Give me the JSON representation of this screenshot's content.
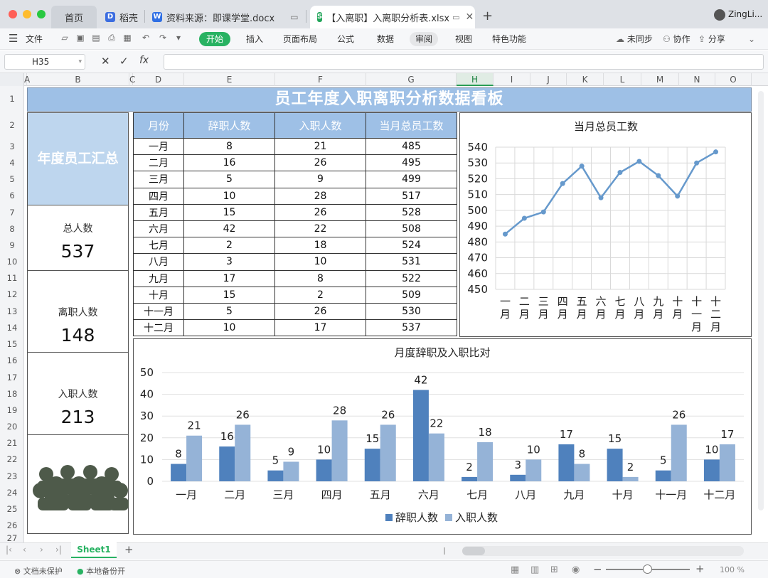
{
  "titlebar": {
    "tabs": [
      {
        "label": "首页"
      },
      {
        "label": "稻壳"
      },
      {
        "label": "资料来源：即课学堂.docx"
      },
      {
        "label": "【入离职】入离职分析表.xlsx"
      }
    ],
    "new_tab": "+",
    "user": "ZingLi..."
  },
  "menu": {
    "file": "文件",
    "items": [
      "开始",
      "插入",
      "页面布局",
      "公式",
      "数据",
      "审阅",
      "视图",
      "特色功能"
    ],
    "right": [
      "未同步",
      "协作",
      "分享"
    ]
  },
  "formula": {
    "cell_ref": "H35",
    "fx": "fx",
    "value": ""
  },
  "columns": [
    "A",
    "B",
    "C",
    "D",
    "E",
    "F",
    "G",
    "H",
    "I",
    "J",
    "K",
    "L",
    "M",
    "N",
    "O"
  ],
  "rows": [
    "1",
    "2",
    "3",
    "4",
    "5",
    "6",
    "7",
    "8",
    "9",
    "10",
    "11",
    "12",
    "13",
    "14",
    "15",
    "16",
    "17",
    "18",
    "19",
    "20",
    "21",
    "22",
    "23",
    "24",
    "25",
    "26",
    "27"
  ],
  "dashboard": {
    "title": "员工年度入职离职分析数据看板",
    "summary_header": "年度员工汇总",
    "kpis": [
      {
        "label": "总人数",
        "value": "537"
      },
      {
        "label": "离职人数",
        "value": "148"
      },
      {
        "label": "入职人数",
        "value": "213"
      }
    ],
    "table": {
      "headers": [
        "月份",
        "辞职人数",
        "入职人数",
        "当月总员工数"
      ],
      "rows": [
        [
          "一月",
          "8",
          "21",
          "485"
        ],
        [
          "二月",
          "16",
          "26",
          "495"
        ],
        [
          "三月",
          "5",
          "9",
          "499"
        ],
        [
          "四月",
          "10",
          "28",
          "517"
        ],
        [
          "五月",
          "15",
          "26",
          "528"
        ],
        [
          "六月",
          "42",
          "22",
          "508"
        ],
        [
          "七月",
          "2",
          "18",
          "524"
        ],
        [
          "八月",
          "3",
          "10",
          "531"
        ],
        [
          "九月",
          "17",
          "8",
          "522"
        ],
        [
          "十月",
          "15",
          "2",
          "509"
        ],
        [
          "十一月",
          "5",
          "26",
          "530"
        ],
        [
          "十二月",
          "10",
          "17",
          "537"
        ]
      ]
    },
    "colors": {
      "banner": "#9ec0e6",
      "summary": "#bed6ee",
      "line": "#6699cc",
      "bar_resign": "#4f81bd",
      "bar_hire": "#95b3d7",
      "icon": "#4e5a4a"
    }
  },
  "chart_data": [
    {
      "type": "line",
      "title": "当月总员工数",
      "categories": [
        "一月",
        "二月",
        "三月",
        "四月",
        "五月",
        "六月",
        "七月",
        "八月",
        "九月",
        "十月",
        "十一月",
        "十二月"
      ],
      "values": [
        485,
        495,
        499,
        517,
        528,
        508,
        524,
        531,
        522,
        509,
        530,
        537
      ],
      "ylim": [
        450,
        540
      ],
      "yticks": [
        "450",
        "460",
        "470",
        "480",
        "490",
        "500",
        "510",
        "520",
        "530",
        "540"
      ],
      "grid": true
    },
    {
      "type": "bar",
      "title": "月度辞职及入职比对",
      "categories": [
        "一月",
        "二月",
        "三月",
        "四月",
        "五月",
        "六月",
        "七月",
        "八月",
        "九月",
        "十月",
        "十一月",
        "十二月"
      ],
      "series": [
        {
          "name": "辞职人数",
          "values": [
            8,
            16,
            5,
            10,
            15,
            42,
            2,
            3,
            17,
            15,
            5,
            10
          ]
        },
        {
          "name": "入职人数",
          "values": [
            21,
            26,
            9,
            28,
            26,
            22,
            18,
            10,
            8,
            2,
            26,
            17
          ]
        }
      ],
      "ylim": [
        0,
        50
      ],
      "yticks": [
        "0",
        "10",
        "20",
        "30",
        "40",
        "50"
      ],
      "legend": "bottom"
    }
  ],
  "sheet": {
    "tab": "Sheet1",
    "add": "+"
  },
  "status": {
    "protect": "文档未保护",
    "backup": "本地备份开",
    "zoom": "100 %"
  }
}
